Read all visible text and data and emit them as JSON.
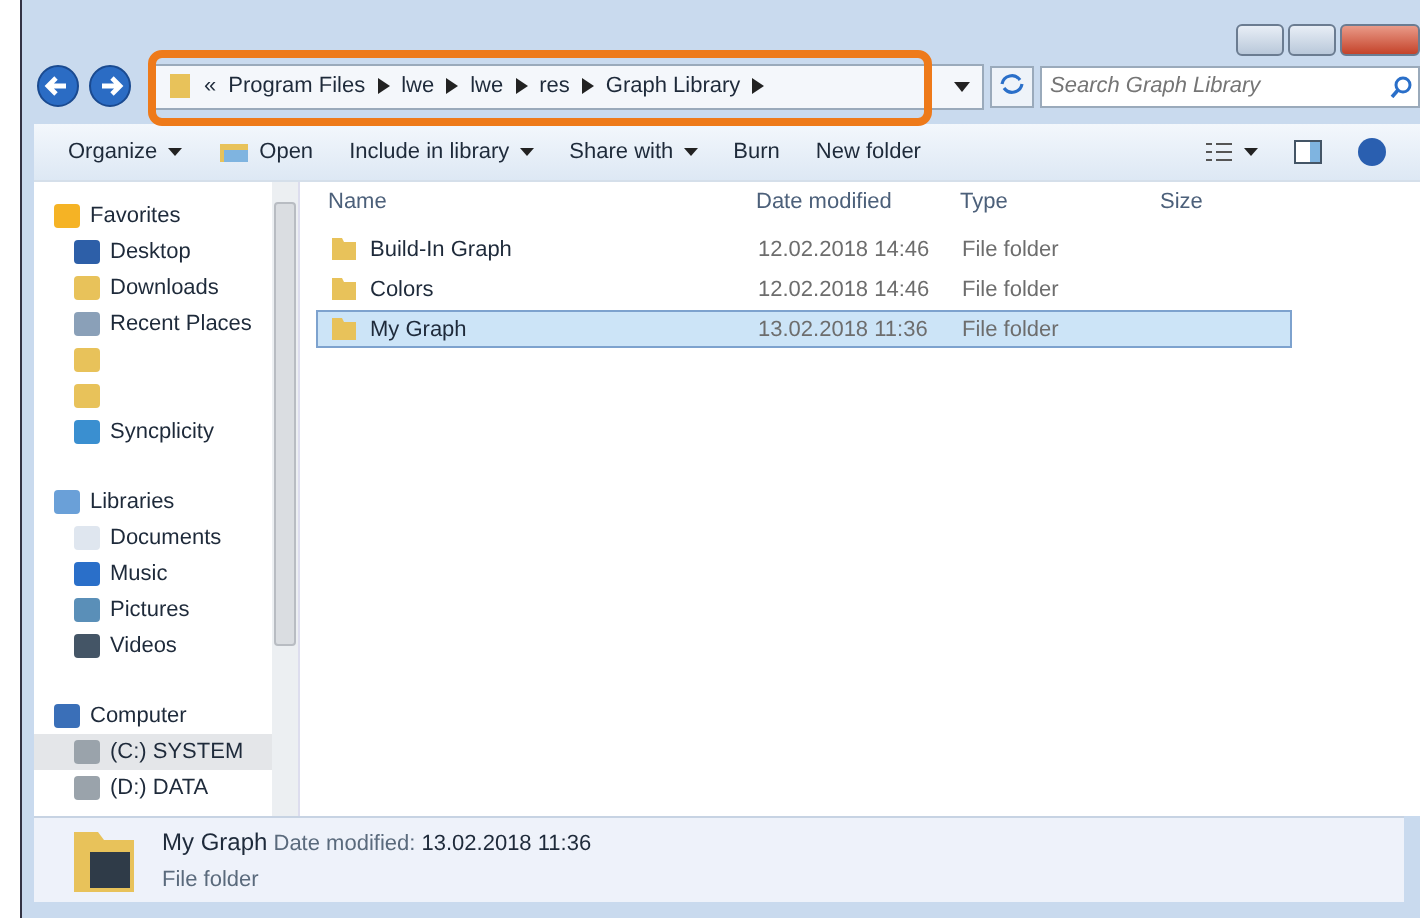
{
  "address": {
    "overflow": "«",
    "crumbs": [
      "Program Files",
      "lwe",
      "lwe",
      "res",
      "Graph Library"
    ]
  },
  "search": {
    "placeholder": "Search Graph Library"
  },
  "toolbar": [
    {
      "label": "Organize",
      "kind": "menu"
    },
    {
      "label": "Open",
      "kind": "icon"
    },
    {
      "label": "Include in library",
      "kind": "menu"
    },
    {
      "label": "Share with",
      "kind": "menu"
    },
    {
      "label": "Burn",
      "kind": "plain"
    },
    {
      "label": "New folder",
      "kind": "plain"
    }
  ],
  "sidebar": [
    {
      "label": "Favorites",
      "kind": "star",
      "children": [
        {
          "label": "Desktop",
          "kind": "desktop",
          "selected": false
        },
        {
          "label": "Downloads",
          "kind": "folder",
          "selected": false
        },
        {
          "label": "Recent Places",
          "kind": "recent",
          "selected": false
        },
        {
          "kind": "folder",
          "selected": false
        },
        {
          "kind": "folder",
          "selected": false
        },
        {
          "label": "Syncplicity",
          "kind": "sync",
          "selected": false
        }
      ]
    },
    {
      "label": "Libraries",
      "kind": "library",
      "children": [
        {
          "label": "Documents",
          "kind": "doc",
          "selected": false
        },
        {
          "label": "Music",
          "kind": "music",
          "selected": false
        },
        {
          "label": "Pictures",
          "kind": "pic",
          "selected": false
        },
        {
          "label": "Videos",
          "kind": "video",
          "selected": false
        }
      ]
    },
    {
      "label": "Computer",
      "kind": "computer",
      "children": [
        {
          "label": "(C:) SYSTEM",
          "kind": "drive",
          "selected": true
        },
        {
          "label": "(D:) DATA",
          "kind": "drive",
          "selected": false
        }
      ]
    }
  ],
  "table": {
    "columns": [
      "Name",
      "Date modified",
      "Type",
      "Size"
    ],
    "rows": [
      {
        "name": "Build-In Graph",
        "date": "12.02.2018 14:46",
        "type": "File folder",
        "selected": false
      },
      {
        "name": "Colors",
        "date": "12.02.2018 14:46",
        "type": "File folder",
        "selected": false
      },
      {
        "name": "My Graph",
        "date": "13.02.2018 11:36",
        "type": "File folder",
        "selected": true
      }
    ]
  },
  "details": {
    "name": "My Graph",
    "date_label": "Date modified:",
    "date": "13.02.2018 11:36",
    "type": "File folder"
  }
}
